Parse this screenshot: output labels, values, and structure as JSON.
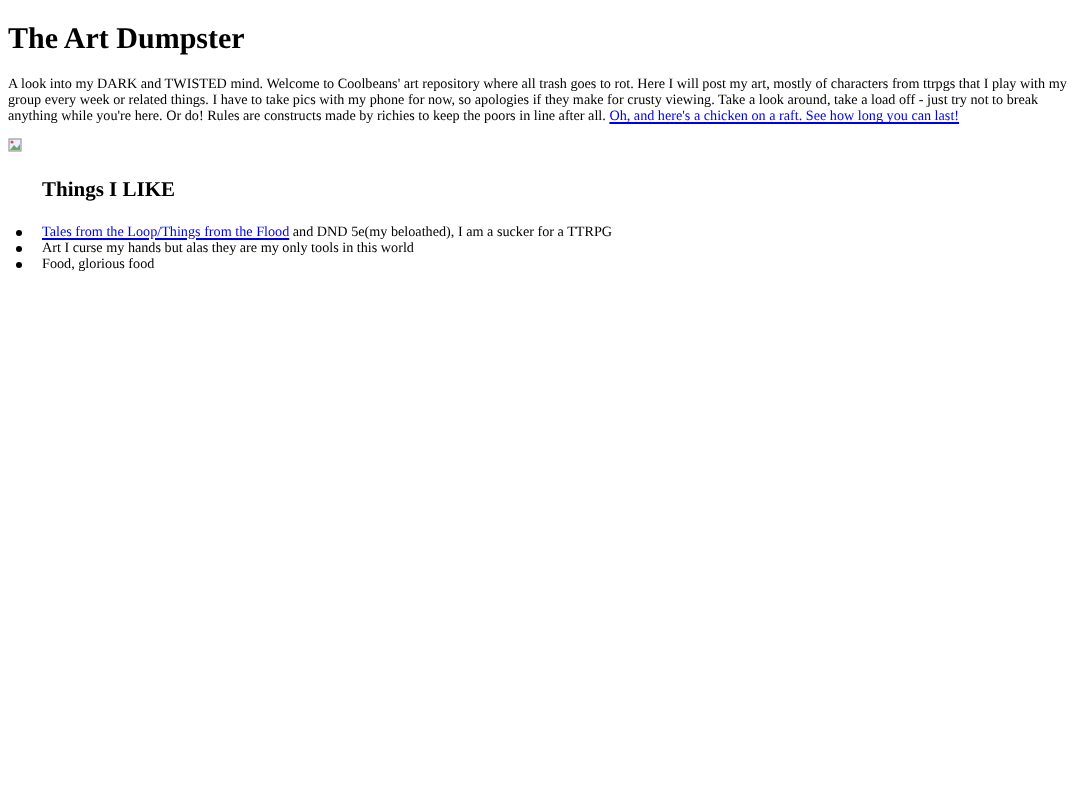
{
  "title": "The Art Dumpster",
  "intro": {
    "text": "A look into my DARK and TWISTED mind. Welcome to Coolbeans' art repository where all trash goes to rot. Here I will post my art, mostly of characters from ttrpgs that I play with my group every week or related things. I have to take pics with my phone for now, so apologies if they make for crusty viewing. Take a look around, take a load off - just try not to break anything while you're here. Or do! Rules are constructs made by richies to keep the poors in line after all.",
    "link": "Oh, and here's a chicken on a raft. See how long you can last!"
  },
  "image": {
    "kind": "broken"
  },
  "likes_heading": "Things I LIKE",
  "likes": [
    {
      "link": "Tales from the Loop/Things from the Flood",
      "text": "and DND 5e(my beloathed), I am a sucker for a TTRPG"
    },
    {
      "text": "Art I curse my hands but alas they are my only tools in this world"
    },
    {
      "text": "Food, glorious food"
    }
  ]
}
